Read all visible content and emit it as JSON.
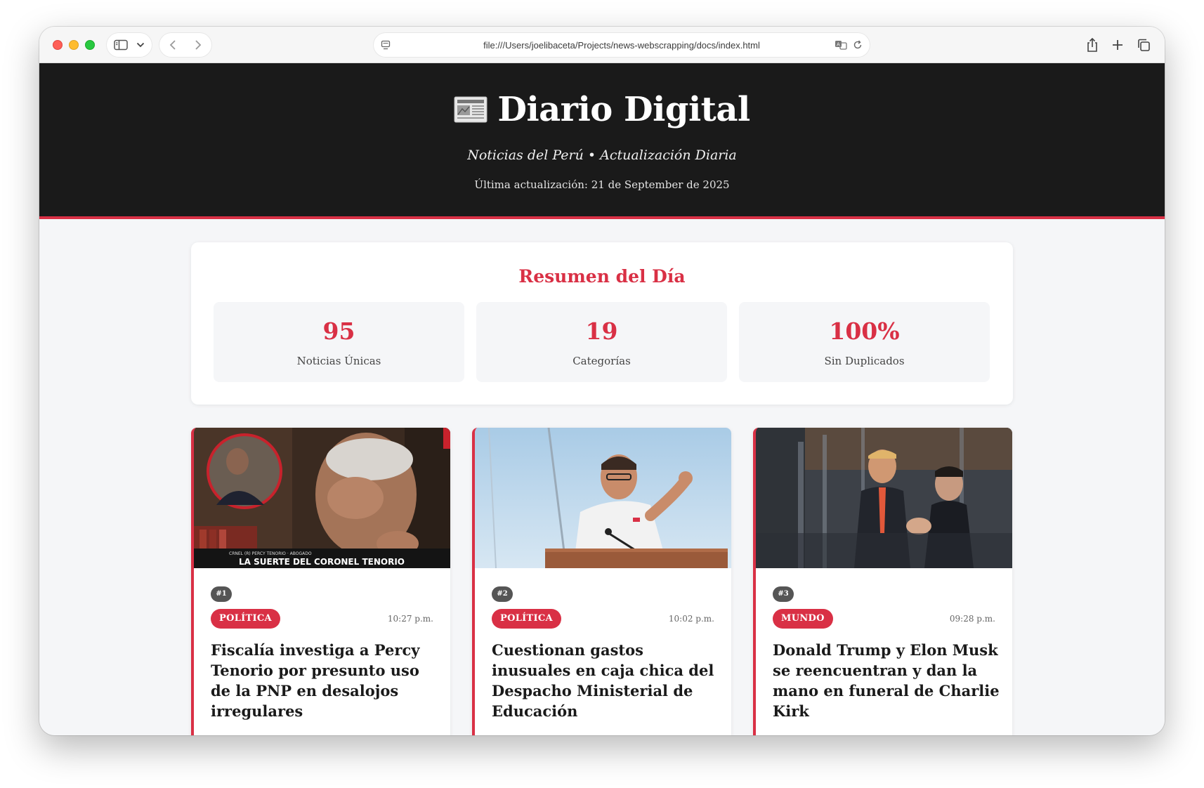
{
  "browser": {
    "url": "file:///Users/joelibaceta/Projects/news-webscrapping/docs/index.html"
  },
  "header": {
    "title": "Diario Digital",
    "tagline": "Noticias del Perú • Actualización Diaria",
    "updated": "Última actualización: 21 de September de 2025"
  },
  "summary": {
    "title": "Resumen del Día",
    "stats": [
      {
        "value": "95",
        "label": "Noticias Únicas"
      },
      {
        "value": "19",
        "label": "Categorías"
      },
      {
        "value": "100%",
        "label": "Sin Duplicados"
      }
    ]
  },
  "articles": [
    {
      "rank": "#1",
      "category": "POLÍTICA",
      "time": "10:27 p.m.",
      "title": "Fiscalía investiga a Percy Tenorio por presunto uso de la PNP en desalojos irregulares",
      "image_caption": "LA SUERTE DEL CORONEL TENORIO",
      "image_subcaption": "CRNEL (R) PERCY TENORIO · ABOGADO"
    },
    {
      "rank": "#2",
      "category": "POLÍTICA",
      "time": "10:02 p.m.",
      "title": "Cuestionan gastos inusuales en caja chica del Despacho Ministerial de Educación"
    },
    {
      "rank": "#3",
      "category": "MUNDO",
      "time": "09:28 p.m.",
      "title": "Donald Trump y Elon Musk se reencuentran y dan la mano en funeral de Charlie Kirk"
    }
  ],
  "colors": {
    "accent": "#d93045",
    "masthead": "#1a1a1a",
    "background": "#f5f6f8"
  }
}
